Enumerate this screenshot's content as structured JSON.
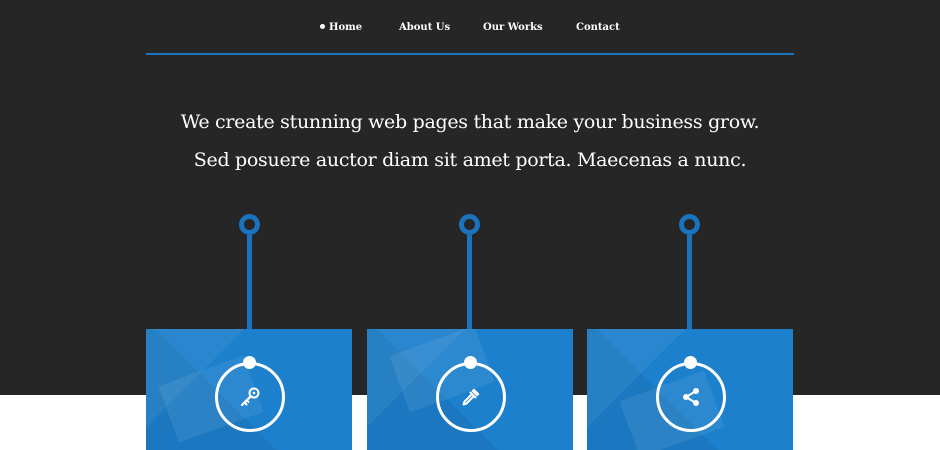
{
  "nav": {
    "items": [
      {
        "label": "Home",
        "active": true
      },
      {
        "label": "About Us",
        "active": false
      },
      {
        "label": "Our Works",
        "active": false
      },
      {
        "label": "Contact",
        "active": false
      }
    ]
  },
  "hero": {
    "line1": "We create stunning web pages that make your business grow.",
    "line2": "Sed posuere auctor diam sit amet porta. Maecenas a nunc."
  },
  "cards": [
    {
      "icon": "key-icon"
    },
    {
      "icon": "pipette-icon"
    },
    {
      "icon": "share-icon"
    }
  ],
  "colors": {
    "background_dark": "#262626",
    "accent": "#1a73bd",
    "card": "#1d80cc",
    "text": "#ffffff"
  }
}
